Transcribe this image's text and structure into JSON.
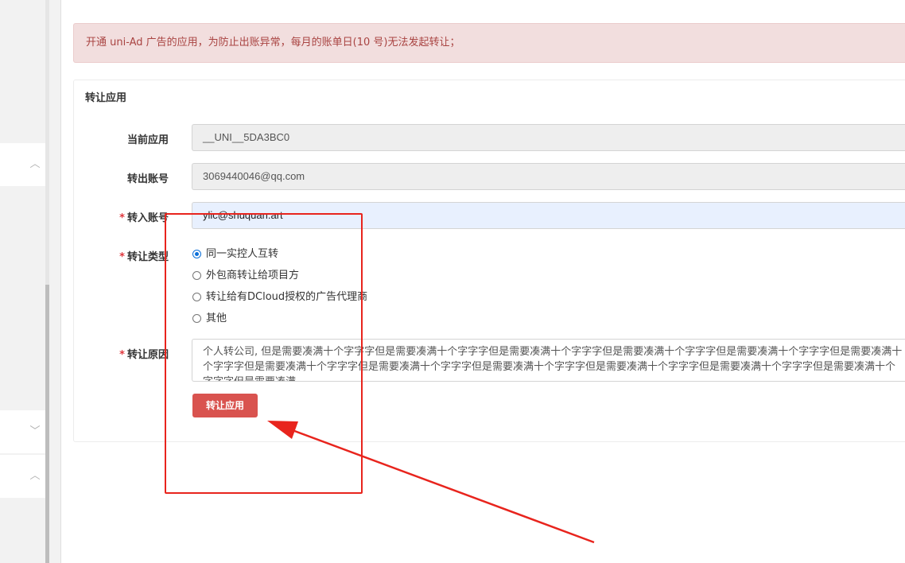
{
  "sidebar": {
    "chevrons": [
      "chevron-up",
      "chevron-down",
      "chevron-up"
    ]
  },
  "alert": {
    "text": "开通 uni-Ad 广告的应用，为防止出账异常，每月的账单日(10 号)无法发起转让；"
  },
  "panel": {
    "title": "转让应用"
  },
  "form": {
    "current_app": {
      "label": "当前应用",
      "value": "__UNI__5DA3BC0"
    },
    "from_account": {
      "label": "转出账号",
      "value": "3069440046@qq.com"
    },
    "to_account": {
      "label": "转入账号",
      "value": "ylic@shuquan.art",
      "required": "*"
    },
    "transfer_type": {
      "label": "转让类型",
      "required": "*",
      "options": [
        "同一实控人互转",
        "外包商转让给项目方",
        "转让给有DCloud授权的广告代理商",
        "其他"
      ],
      "selected": "同一实控人互转"
    },
    "reason": {
      "label": "转让原因",
      "required": "*",
      "value": "个人转公司, 但是需要凑满十个字字字但是需要凑满十个字字字但是需要凑满十个字字字但是需要凑满十个字字字但是需要凑满十个字字字但是需要凑满十个字字字但是需要凑满十个字字字但是需要凑满十个字字字但是需要凑满十个字字字但是需要凑满十个字字字但是需要凑满十个字字字但是需要凑满十个字字字但是需要凑满"
    },
    "submit_label": "转让应用"
  },
  "colors": {
    "alert_bg": "#f2dede",
    "alert_text": "#a94442",
    "button": "#d9534f",
    "annotation": "#e8241d"
  }
}
